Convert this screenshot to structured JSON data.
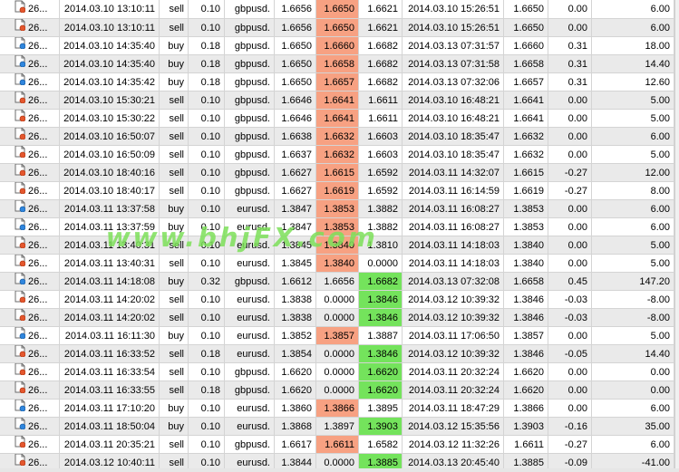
{
  "theme": {
    "alt_row": "#eaeaea",
    "red_highlight": "#f7a182",
    "green_highlight": "#74e35c",
    "watermark_color": "#7de05a"
  },
  "watermark": "www.bhjFX.com",
  "row_icon": "trade-document-icon",
  "rows": [
    {
      "ticket": "26...",
      "open_time": "2014.03.10 13:10:11",
      "type": "sell",
      "size": "0.10",
      "item": "gbpusd.",
      "price1": "1.6656",
      "sl": "1.6650",
      "tp": "1.6621",
      "close_time": "2014.03.10 15:26:51",
      "close_price": "1.6650",
      "swap": "0.00",
      "profit": "6.00",
      "hl": "red",
      "hl_col": "sl"
    },
    {
      "ticket": "26...",
      "open_time": "2014.03.10 13:10:11",
      "type": "sell",
      "size": "0.10",
      "item": "gbpusd.",
      "price1": "1.6656",
      "sl": "1.6650",
      "tp": "1.6621",
      "close_time": "2014.03.10 15:26:51",
      "close_price": "1.6650",
      "swap": "0.00",
      "profit": "6.00",
      "hl": "red",
      "hl_col": "sl"
    },
    {
      "ticket": "26...",
      "open_time": "2014.03.10 14:35:40",
      "type": "buy",
      "size": "0.18",
      "item": "gbpusd.",
      "price1": "1.6650",
      "sl": "1.6660",
      "tp": "1.6682",
      "close_time": "2014.03.13 07:31:57",
      "close_price": "1.6660",
      "swap": "0.31",
      "profit": "18.00",
      "hl": "red",
      "hl_col": "sl"
    },
    {
      "ticket": "26...",
      "open_time": "2014.03.10 14:35:40",
      "type": "buy",
      "size": "0.18",
      "item": "gbpusd.",
      "price1": "1.6650",
      "sl": "1.6658",
      "tp": "1.6682",
      "close_time": "2014.03.13 07:31:58",
      "close_price": "1.6658",
      "swap": "0.31",
      "profit": "14.40",
      "hl": "red",
      "hl_col": "sl"
    },
    {
      "ticket": "26...",
      "open_time": "2014.03.10 14:35:42",
      "type": "buy",
      "size": "0.18",
      "item": "gbpusd.",
      "price1": "1.6650",
      "sl": "1.6657",
      "tp": "1.6682",
      "close_time": "2014.03.13 07:32:06",
      "close_price": "1.6657",
      "swap": "0.31",
      "profit": "12.60",
      "hl": "red",
      "hl_col": "sl"
    },
    {
      "ticket": "26...",
      "open_time": "2014.03.10 15:30:21",
      "type": "sell",
      "size": "0.10",
      "item": "gbpusd.",
      "price1": "1.6646",
      "sl": "1.6641",
      "tp": "1.6611",
      "close_time": "2014.03.10 16:48:21",
      "close_price": "1.6641",
      "swap": "0.00",
      "profit": "5.00",
      "hl": "red",
      "hl_col": "sl"
    },
    {
      "ticket": "26...",
      "open_time": "2014.03.10 15:30:22",
      "type": "sell",
      "size": "0.10",
      "item": "gbpusd.",
      "price1": "1.6646",
      "sl": "1.6641",
      "tp": "1.6611",
      "close_time": "2014.03.10 16:48:21",
      "close_price": "1.6641",
      "swap": "0.00",
      "profit": "5.00",
      "hl": "red",
      "hl_col": "sl"
    },
    {
      "ticket": "26...",
      "open_time": "2014.03.10 16:50:07",
      "type": "sell",
      "size": "0.10",
      "item": "gbpusd.",
      "price1": "1.6638",
      "sl": "1.6632",
      "tp": "1.6603",
      "close_time": "2014.03.10 18:35:47",
      "close_price": "1.6632",
      "swap": "0.00",
      "profit": "6.00",
      "hl": "red",
      "hl_col": "sl"
    },
    {
      "ticket": "26...",
      "open_time": "2014.03.10 16:50:09",
      "type": "sell",
      "size": "0.10",
      "item": "gbpusd.",
      "price1": "1.6637",
      "sl": "1.6632",
      "tp": "1.6603",
      "close_time": "2014.03.10 18:35:47",
      "close_price": "1.6632",
      "swap": "0.00",
      "profit": "5.00",
      "hl": "red",
      "hl_col": "sl"
    },
    {
      "ticket": "26...",
      "open_time": "2014.03.10 18:40:16",
      "type": "sell",
      "size": "0.10",
      "item": "gbpusd.",
      "price1": "1.6627",
      "sl": "1.6615",
      "tp": "1.6592",
      "close_time": "2014.03.11 14:32:07",
      "close_price": "1.6615",
      "swap": "-0.27",
      "profit": "12.00",
      "hl": "red",
      "hl_col": "sl"
    },
    {
      "ticket": "26...",
      "open_time": "2014.03.10 18:40:17",
      "type": "sell",
      "size": "0.10",
      "item": "gbpusd.",
      "price1": "1.6627",
      "sl": "1.6619",
      "tp": "1.6592",
      "close_time": "2014.03.11 16:14:59",
      "close_price": "1.6619",
      "swap": "-0.27",
      "profit": "8.00",
      "hl": "red",
      "hl_col": "sl"
    },
    {
      "ticket": "26...",
      "open_time": "2014.03.11 13:37:58",
      "type": "buy",
      "size": "0.10",
      "item": "eurusd.",
      "price1": "1.3847",
      "sl": "1.3853",
      "tp": "1.3882",
      "close_time": "2014.03.11 16:08:27",
      "close_price": "1.3853",
      "swap": "0.00",
      "profit": "6.00",
      "hl": "red",
      "hl_col": "sl"
    },
    {
      "ticket": "26...",
      "open_time": "2014.03.11 13:37:59",
      "type": "buy",
      "size": "0.10",
      "item": "eurusd.",
      "price1": "1.3847",
      "sl": "1.3853",
      "tp": "1.3882",
      "close_time": "2014.03.11 16:08:27",
      "close_price": "1.3853",
      "swap": "0.00",
      "profit": "6.00",
      "hl": "red",
      "hl_col": "sl"
    },
    {
      "ticket": "26...",
      "open_time": "2014.03.11 13:40:31",
      "type": "sell",
      "size": "0.10",
      "item": "eurusd.",
      "price1": "1.3845",
      "sl": "1.3840",
      "tp": "1.3810",
      "close_time": "2014.03.11 14:18:03",
      "close_price": "1.3840",
      "swap": "0.00",
      "profit": "5.00",
      "hl": "red",
      "hl_col": "sl"
    },
    {
      "ticket": "26...",
      "open_time": "2014.03.11 13:40:31",
      "type": "sell",
      "size": "0.10",
      "item": "eurusd.",
      "price1": "1.3845",
      "sl": "1.3840",
      "tp": "0.0000",
      "close_time": "2014.03.11 14:18:03",
      "close_price": "1.3840",
      "swap": "0.00",
      "profit": "5.00",
      "hl": "red",
      "hl_col": "sl"
    },
    {
      "ticket": "26...",
      "open_time": "2014.03.11 14:18:08",
      "type": "buy",
      "size": "0.32",
      "item": "gbpusd.",
      "price1": "1.6612",
      "sl": "1.6656",
      "tp": "1.6682",
      "close_time": "2014.03.13 07:32:08",
      "close_price": "1.6658",
      "swap": "0.45",
      "profit": "147.20",
      "hl": "green",
      "hl_col": "tp"
    },
    {
      "ticket": "26...",
      "open_time": "2014.03.11 14:20:02",
      "type": "sell",
      "size": "0.10",
      "item": "eurusd.",
      "price1": "1.3838",
      "sl": "0.0000",
      "tp": "1.3846",
      "close_time": "2014.03.12 10:39:32",
      "close_price": "1.3846",
      "swap": "-0.03",
      "profit": "-8.00",
      "hl": "green",
      "hl_col": "tp"
    },
    {
      "ticket": "26...",
      "open_time": "2014.03.11 14:20:02",
      "type": "sell",
      "size": "0.10",
      "item": "eurusd.",
      "price1": "1.3838",
      "sl": "0.0000",
      "tp": "1.3846",
      "close_time": "2014.03.12 10:39:32",
      "close_price": "1.3846",
      "swap": "-0.03",
      "profit": "-8.00",
      "hl": "green",
      "hl_col": "tp"
    },
    {
      "ticket": "26...",
      "open_time": "2014.03.11 16:11:30",
      "type": "buy",
      "size": "0.10",
      "item": "eurusd.",
      "price1": "1.3852",
      "sl": "1.3857",
      "tp": "1.3887",
      "close_time": "2014.03.11 17:06:50",
      "close_price": "1.3857",
      "swap": "0.00",
      "profit": "5.00",
      "hl": "red",
      "hl_col": "sl"
    },
    {
      "ticket": "26...",
      "open_time": "2014.03.11 16:33:52",
      "type": "sell",
      "size": "0.18",
      "item": "eurusd.",
      "price1": "1.3854",
      "sl": "0.0000",
      "tp": "1.3846",
      "close_time": "2014.03.12 10:39:32",
      "close_price": "1.3846",
      "swap": "-0.05",
      "profit": "14.40",
      "hl": "green",
      "hl_col": "tp"
    },
    {
      "ticket": "26...",
      "open_time": "2014.03.11 16:33:54",
      "type": "sell",
      "size": "0.10",
      "item": "gbpusd.",
      "price1": "1.6620",
      "sl": "0.0000",
      "tp": "1.6620",
      "close_time": "2014.03.11 20:32:24",
      "close_price": "1.6620",
      "swap": "0.00",
      "profit": "0.00",
      "hl": "green",
      "hl_col": "tp"
    },
    {
      "ticket": "26...",
      "open_time": "2014.03.11 16:33:55",
      "type": "sell",
      "size": "0.18",
      "item": "gbpusd.",
      "price1": "1.6620",
      "sl": "0.0000",
      "tp": "1.6620",
      "close_time": "2014.03.11 20:32:24",
      "close_price": "1.6620",
      "swap": "0.00",
      "profit": "0.00",
      "hl": "green",
      "hl_col": "tp"
    },
    {
      "ticket": "26...",
      "open_time": "2014.03.11 17:10:20",
      "type": "buy",
      "size": "0.10",
      "item": "eurusd.",
      "price1": "1.3860",
      "sl": "1.3866",
      "tp": "1.3895",
      "close_time": "2014.03.11 18:47:29",
      "close_price": "1.3866",
      "swap": "0.00",
      "profit": "6.00",
      "hl": "red",
      "hl_col": "sl"
    },
    {
      "ticket": "26...",
      "open_time": "2014.03.11 18:50:04",
      "type": "buy",
      "size": "0.10",
      "item": "eurusd.",
      "price1": "1.3868",
      "sl": "1.3897",
      "tp": "1.3903",
      "close_time": "2014.03.12 15:35:56",
      "close_price": "1.3903",
      "swap": "-0.16",
      "profit": "35.00",
      "hl": "green",
      "hl_col": "tp"
    },
    {
      "ticket": "26...",
      "open_time": "2014.03.11 20:35:21",
      "type": "sell",
      "size": "0.10",
      "item": "gbpusd.",
      "price1": "1.6617",
      "sl": "1.6611",
      "tp": "1.6582",
      "close_time": "2014.03.12 11:32:26",
      "close_price": "1.6611",
      "swap": "-0.27",
      "profit": "6.00",
      "hl": "red",
      "hl_col": "sl"
    },
    {
      "ticket": "26...",
      "open_time": "2014.03.12 10:40:11",
      "type": "sell",
      "size": "0.10",
      "item": "eurusd.",
      "price1": "1.3844",
      "sl": "0.0000",
      "tp": "1.3885",
      "close_time": "2014.03.13 20:45:40",
      "close_price": "1.3885",
      "swap": "-0.09",
      "profit": "-41.00",
      "hl": "green",
      "hl_col": "tp"
    }
  ]
}
